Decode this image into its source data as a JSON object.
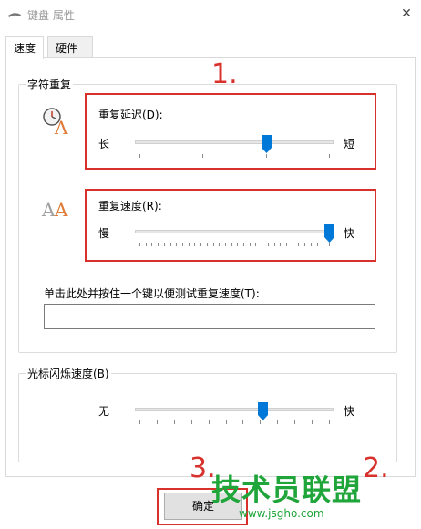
{
  "window": {
    "title": "键盘 属性",
    "close_glyph": "✕"
  },
  "tabs": [
    {
      "label": "速度",
      "active": true
    },
    {
      "label": "硬件",
      "active": false
    }
  ],
  "char_repeat": {
    "group_label": "字符重复",
    "delay": {
      "label": "重复延迟(D):",
      "min_label": "长",
      "max_label": "短",
      "value_fraction": 0.67,
      "tick_count": 4
    },
    "rate": {
      "label": "重复速度(R):",
      "min_label": "慢",
      "max_label": "快",
      "value_fraction": 1.0,
      "tick_count": 32
    },
    "test_prompt": "单击此处并按住一个键以便测试重复速度(T):",
    "test_value": ""
  },
  "cursor_blink": {
    "group_label": "光标闪烁速度(B)",
    "min_label": "无",
    "max_label": "快",
    "value_fraction": 0.65,
    "tick_count": 12
  },
  "buttons": {
    "ok": "确定"
  },
  "annotations": {
    "step1": "1.",
    "step2": "2.",
    "step3": "3."
  },
  "watermark": {
    "text": "技术员联盟",
    "url": "www.jsgho.com"
  },
  "colors": {
    "accent": "#0078d7",
    "annotation": "#d8312b",
    "watermark": "#1fa53a"
  }
}
